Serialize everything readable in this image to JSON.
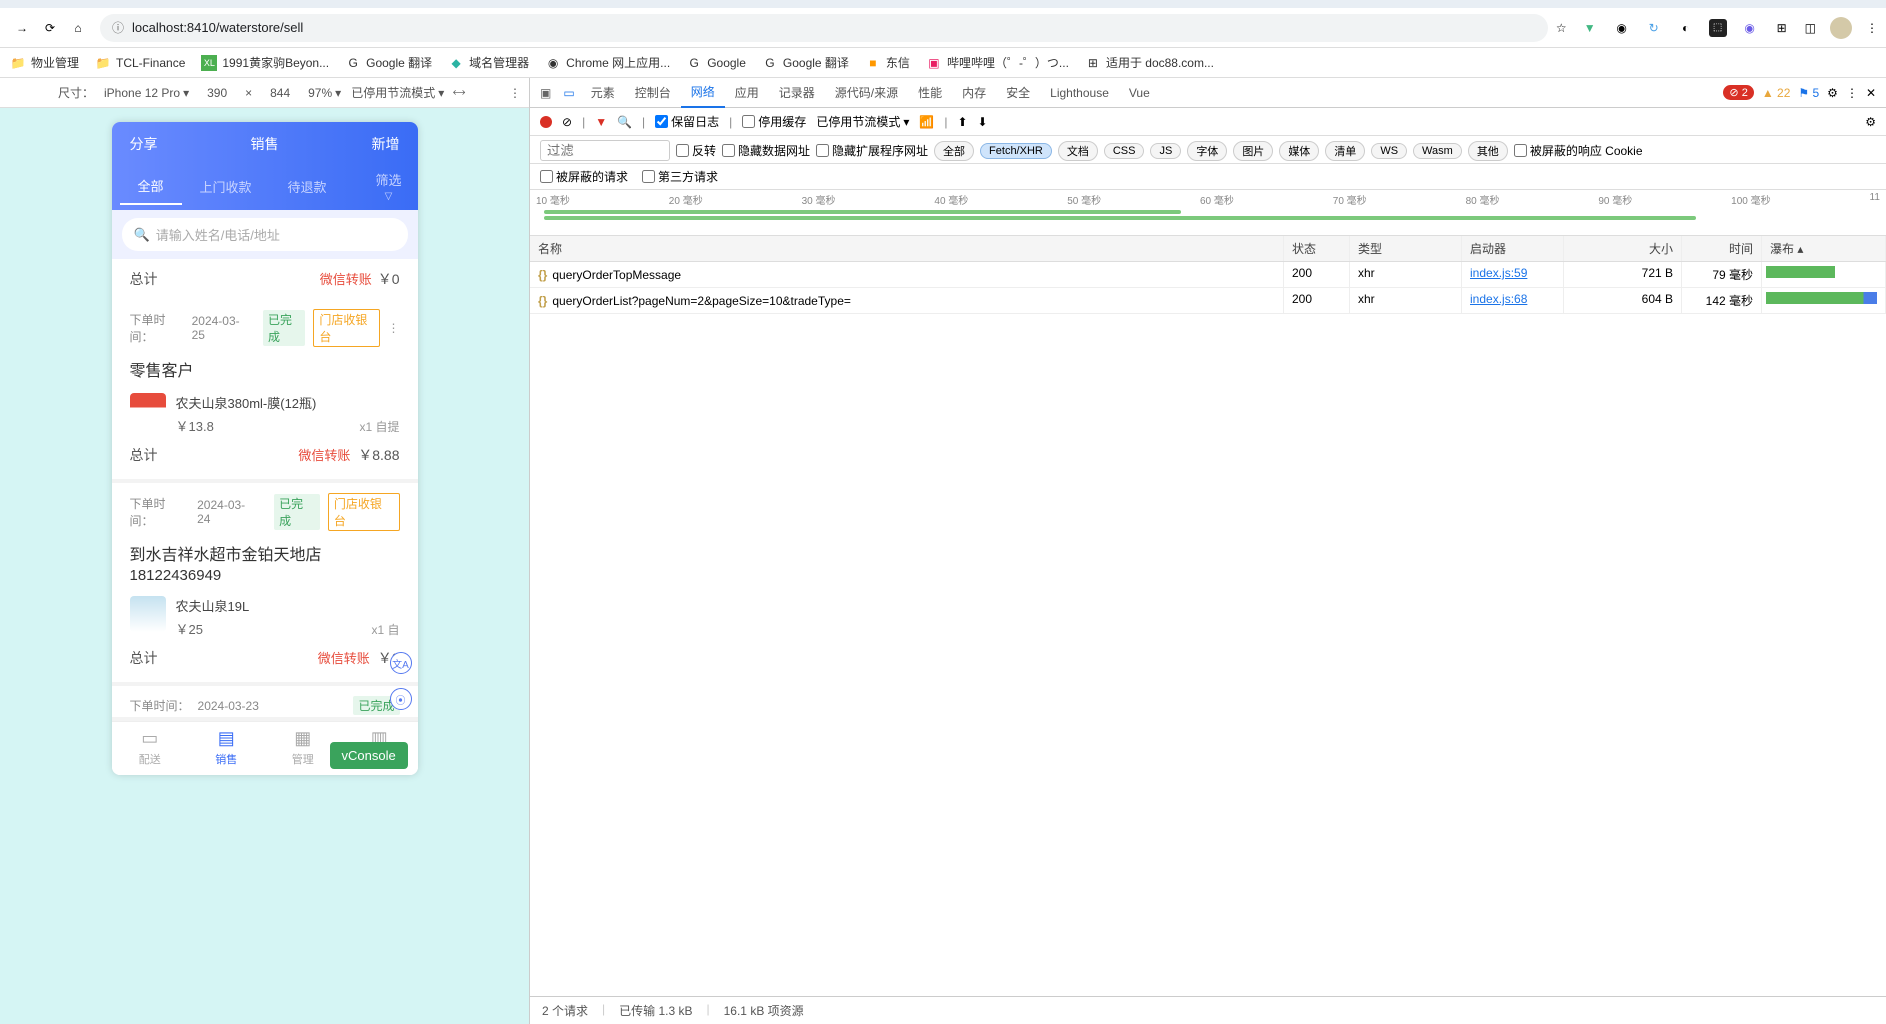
{
  "browser": {
    "url": "localhost:8410/waterstore/sell"
  },
  "bookmarks": [
    {
      "label": "物业管理"
    },
    {
      "label": "TCL-Finance"
    },
    {
      "label": "1991黄家驹Beyon..."
    },
    {
      "label": "Google 翻译"
    },
    {
      "label": "域名管理器"
    },
    {
      "label": "Chrome 网上应用..."
    },
    {
      "label": "Google"
    },
    {
      "label": "Google 翻译"
    },
    {
      "label": "东信"
    },
    {
      "label": "哔哩哔哩（゜-゜）つ..."
    },
    {
      "label": "适用于 doc88.com..."
    }
  ],
  "device_bar": {
    "label": "尺寸：",
    "device": "iPhone 12 Pro",
    "width": "390",
    "x": "×",
    "height": "844",
    "zoom": "97%",
    "throttle": "已停用节流模式"
  },
  "phone": {
    "header": {
      "left": "分享",
      "center": "销售",
      "right": "新增"
    },
    "tabs": {
      "all": "全部",
      "door": "上门收款",
      "refund": "待退款",
      "filter": "筛选"
    },
    "search_placeholder": "请输入姓名/电话/地址",
    "payment_label": "微信转账",
    "total_label": "总计",
    "first_total_value": "￥0",
    "orders": [
      {
        "time_label": "下单时间：",
        "time": "2024-03-25",
        "tag1": "已完成",
        "tag2": "门店收银台",
        "customer": "零售客户",
        "item_name": "农夫山泉380ml-膜(12瓶)",
        "item_price": "￥13.8",
        "item_qty": "x1 自提",
        "total_val": "￥8.88"
      },
      {
        "time_label": "下单时间：",
        "time": "2024-03-24",
        "tag1": "已完成",
        "tag2": "门店收银台",
        "customer": "到水吉祥水超市金铂天地店",
        "phone": "18122436949",
        "item_name": "农夫山泉19L",
        "item_price": "￥25",
        "item_qty": "x1 自",
        "total_val": "￥0"
      },
      {
        "time_label": "下单时间：",
        "time": "2024-03-23",
        "tag1": "已完成"
      }
    ],
    "vconsole": "vConsole",
    "bottom_nav": [
      {
        "label": "配送"
      },
      {
        "label": "销售"
      },
      {
        "label": "管理"
      },
      {
        "label": "统计"
      }
    ]
  },
  "devtools": {
    "tabs": [
      "元素",
      "控制台",
      "网络",
      "应用",
      "记录器",
      "源代码/来源",
      "性能",
      "内存",
      "安全",
      "Lighthouse",
      "Vue"
    ],
    "active_tab": "网络",
    "badges": {
      "err": "2",
      "warn": "22",
      "info": "5"
    },
    "toolbar": {
      "keep_log": "保留日志",
      "disable_cache": "停用缓存",
      "throttle": "已停用节流模式"
    },
    "filter_placeholder": "过滤",
    "filter_row": {
      "invert": "反转",
      "hide_data": "隐藏数据网址",
      "hide_ext": "隐藏扩展程序网址",
      "pills": [
        "全部",
        "Fetch/XHR",
        "文档",
        "CSS",
        "JS",
        "字体",
        "图片",
        "媒体",
        "清单",
        "WS",
        "Wasm",
        "其他"
      ],
      "active_pill": "Fetch/XHR",
      "blocked_cookie": "被屏蔽的响应 Cookie"
    },
    "row3": {
      "blocked": "被屏蔽的请求",
      "third": "第三方请求"
    },
    "timeline_ticks": [
      "10 毫秒",
      "20 毫秒",
      "30 毫秒",
      "40 毫秒",
      "50 毫秒",
      "60 毫秒",
      "70 毫秒",
      "80 毫秒",
      "90 毫秒",
      "100 毫秒",
      "11"
    ],
    "table_head": {
      "name": "名称",
      "status": "状态",
      "type": "类型",
      "initiator": "启动器",
      "size": "大小",
      "time": "时间",
      "waterfall": "瀑布"
    },
    "requests": [
      {
        "name": "queryOrderTopMessage",
        "status": "200",
        "type": "xhr",
        "initiator": "index.js:59",
        "size": "721 B",
        "time": "79 毫秒"
      },
      {
        "name": "queryOrderList?pageNum=2&pageSize=10&tradeType=",
        "status": "200",
        "type": "xhr",
        "initiator": "index.js:68",
        "size": "604 B",
        "time": "142 毫秒"
      }
    ],
    "status": {
      "count": "2 个请求",
      "transferred": "已传输 1.3 kB",
      "resources": "16.1 kB 项资源"
    }
  }
}
